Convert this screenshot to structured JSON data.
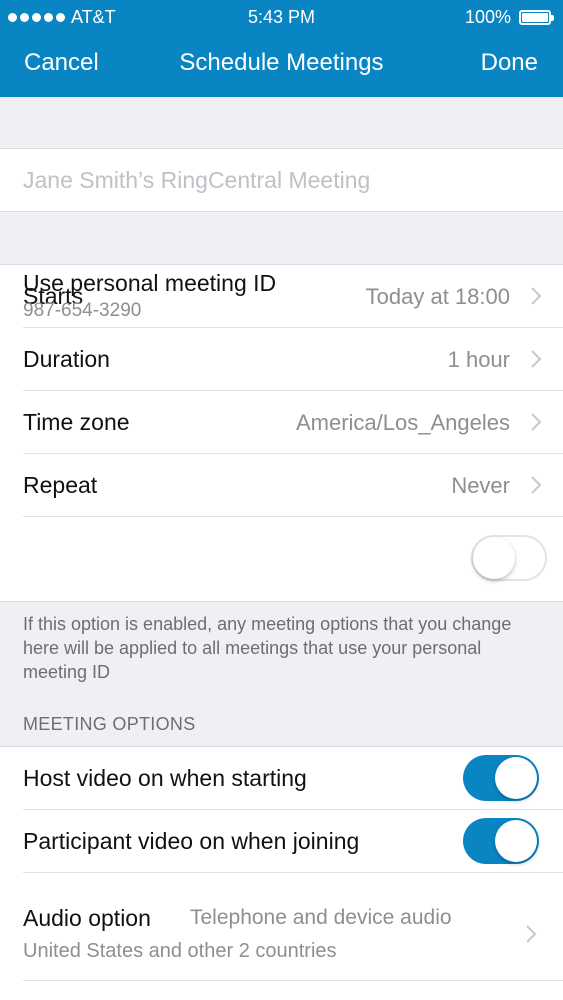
{
  "status_bar": {
    "carrier": "AT&T",
    "time": "5:43 PM",
    "battery": "100%"
  },
  "nav": {
    "cancel_label": "Cancel",
    "title": "Schedule Meetings",
    "done_label": "Done"
  },
  "meeting_title": {
    "placeholder": "Jane Smith’s RingCentral Meeting",
    "value": ""
  },
  "rows": [
    {
      "label": "Starts",
      "value": "Today at 18:00"
    },
    {
      "label": "Duration",
      "value": "1 hour"
    },
    {
      "label": "Time zone",
      "value": "America/Los_Angeles"
    },
    {
      "label": "Repeat",
      "value": "Never"
    }
  ],
  "personal_meeting_id": {
    "label": "Use personal meeting ID",
    "id": "987-654-3290",
    "enabled": false
  },
  "info_text": "If this option is enabled, any meeting options that you change here will be applied to all meetings that use your personal meeting ID",
  "meeting_options": {
    "header": "MEETING OPTIONS",
    "host_video": {
      "label": "Host video on when starting",
      "enabled": true
    },
    "participant_video": {
      "label": "Participant video on when joining",
      "enabled": true
    },
    "audio": {
      "label": "Audio option",
      "value": "Telephone and device audio",
      "sub": "United States and other 2 countries"
    }
  },
  "colors": {
    "accent": "#0a85c4",
    "background": "#efeff4",
    "secondary_text": "#8e8e93"
  }
}
